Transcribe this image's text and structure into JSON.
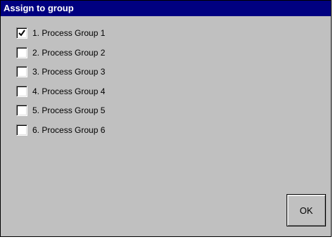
{
  "dialog": {
    "title": "Assign to group"
  },
  "groups": [
    {
      "label": "1. Process Group 1",
      "checked": true
    },
    {
      "label": "2. Process Group 2",
      "checked": false
    },
    {
      "label": "3. Process Group 3",
      "checked": false
    },
    {
      "label": "4. Process Group 4",
      "checked": false
    },
    {
      "label": "5. Process Group 5",
      "checked": false
    },
    {
      "label": "6. Process Group 6",
      "checked": false
    }
  ],
  "buttons": {
    "ok_label": "OK"
  },
  "colors": {
    "titlebar_bg": "#000080",
    "titlebar_text": "#ffffff",
    "window_bg": "#c0c0c0"
  }
}
